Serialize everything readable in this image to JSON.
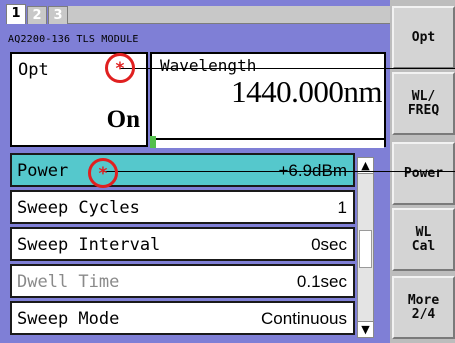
{
  "tabs": [
    {
      "label": "1",
      "active": true
    },
    {
      "label": "2",
      "active": false
    },
    {
      "label": "3",
      "active": false
    }
  ],
  "module_title": "AQ2200-136 TLS MODULE",
  "opt_panel": {
    "label": "Opt",
    "state": "On"
  },
  "wavelength_panel": {
    "label": "Wavelength",
    "value": "1440.000nm"
  },
  "parameters": [
    {
      "label": "Power",
      "value": "+6.9dBm",
      "selected": true,
      "enabled": true
    },
    {
      "label": "Sweep Cycles",
      "value": "1",
      "selected": false,
      "enabled": true
    },
    {
      "label": "Sweep Interval",
      "value": "0sec",
      "selected": false,
      "enabled": true
    },
    {
      "label": "Dwell Time",
      "value": "0.1sec",
      "selected": false,
      "enabled": false
    },
    {
      "label": "Sweep Mode",
      "value": "Continuous",
      "selected": false,
      "enabled": true
    }
  ],
  "scrollbar": {
    "up": "▲",
    "down": "▼"
  },
  "softkeys": [
    {
      "label": "Opt"
    },
    {
      "label": "WL/\nFREQ"
    },
    {
      "label": "Power"
    },
    {
      "label": "WL\nCal"
    },
    {
      "label": "More\n2/4"
    }
  ],
  "annotations": [
    {
      "symbol": "*"
    },
    {
      "symbol": "*"
    }
  ],
  "colors": {
    "panel_background": "#7f7fd6",
    "selected_row": "#55c8cc",
    "softkey_face": "#d4d4d4",
    "annotation_red": "#e02020",
    "indicator_green": "#53c04c"
  }
}
